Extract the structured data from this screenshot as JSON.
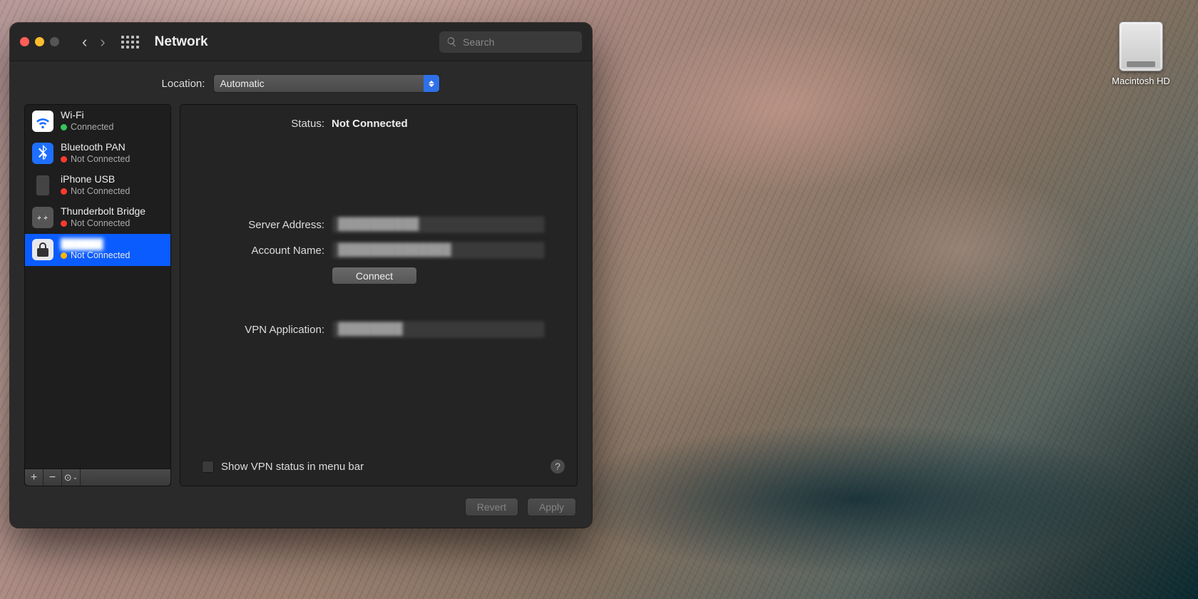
{
  "desktop": {
    "hd_label": "Macintosh HD"
  },
  "window": {
    "title": "Network",
    "search_placeholder": "Search",
    "location_label": "Location:",
    "location_value": "Automatic"
  },
  "sidebar": {
    "services": [
      {
        "name": "Wi-Fi",
        "status": "Connected",
        "dot": "g",
        "icon": "wifi"
      },
      {
        "name": "Bluetooth PAN",
        "status": "Not Connected",
        "dot": "r",
        "icon": "bt"
      },
      {
        "name": "iPhone USB",
        "status": "Not Connected",
        "dot": "r",
        "icon": "usb"
      },
      {
        "name": "Thunderbolt Bridge",
        "status": "Not Connected",
        "dot": "r",
        "icon": "tb"
      },
      {
        "name": "██████",
        "status": "Not Connected",
        "dot": "y",
        "icon": "lock",
        "selected": true
      }
    ]
  },
  "detail": {
    "status_label": "Status:",
    "status_value": "Not Connected",
    "server_label": "Server Address:",
    "server_value": "██████████",
    "account_label": "Account Name:",
    "account_value": "██████████████",
    "connect_button": "Connect",
    "vpnapp_label": "VPN Application:",
    "vpnapp_value": "████████",
    "show_vpn_checkbox": "Show VPN status in menu bar"
  },
  "footer": {
    "revert": "Revert",
    "apply": "Apply"
  }
}
